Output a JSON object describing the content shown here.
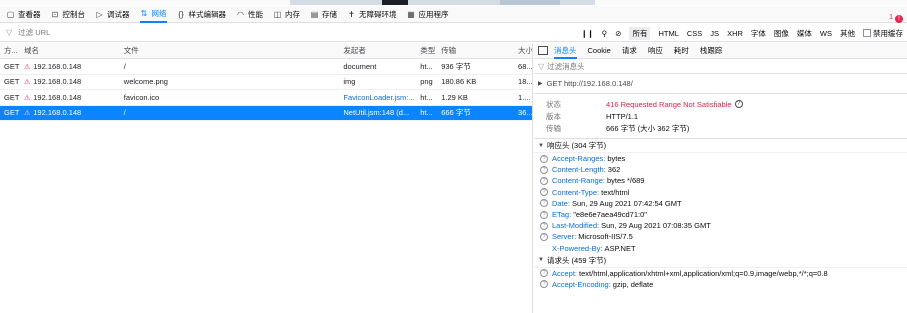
{
  "toolbar": {
    "tools": [
      {
        "label": "查看器",
        "icon": "inspector-icon"
      },
      {
        "label": "控制台",
        "icon": "console-icon"
      },
      {
        "label": "调试器",
        "icon": "debugger-icon"
      },
      {
        "label": "网络",
        "icon": "network-icon"
      },
      {
        "label": "样式编辑器",
        "icon": "style-editor-icon"
      },
      {
        "label": "性能",
        "icon": "performance-icon"
      },
      {
        "label": "内存",
        "icon": "memory-icon"
      },
      {
        "label": "存储",
        "icon": "storage-icon"
      },
      {
        "label": "无障碍环境",
        "icon": "accessibility-icon"
      },
      {
        "label": "应用程序",
        "icon": "application-icon"
      }
    ],
    "error_count": "1"
  },
  "filterbar": {
    "placeholder": "过滤 URL",
    "type_filters": [
      "所有",
      "HTML",
      "CSS",
      "JS",
      "XHR",
      "字体",
      "图像",
      "媒体",
      "WS",
      "其他"
    ],
    "disable_cache_label": "禁用缓存"
  },
  "table": {
    "headers": [
      "方...",
      "域名",
      "文件",
      "发起者",
      "类型",
      "传输",
      "大小"
    ],
    "rows": [
      {
        "method": "GET",
        "domain": "192.168.0.148",
        "file": "/",
        "initiator": "document",
        "type": "ht...",
        "transferred": "936 字节",
        "size": "68...",
        "selected": false
      },
      {
        "method": "GET",
        "domain": "192.168.0.148",
        "file": "welcome.png",
        "initiator": "img",
        "type": "png",
        "transferred": "180.86 KB",
        "size": "18...",
        "selected": false
      },
      {
        "method": "GET",
        "domain": "192.168.0.148",
        "file": "favicon.ico",
        "initiator": "FaviconLoader.jsm:...",
        "type": "ht...",
        "transferred": "1.29 KB",
        "size": "1....",
        "selected": false
      },
      {
        "method": "GET",
        "domain": "192.168.0.148",
        "file": "/",
        "initiator": "NetUtil.jsm:148 (d...",
        "type": "ht...",
        "transferred": "666 字节",
        "size": "36...",
        "selected": true
      }
    ]
  },
  "detail": {
    "tabs": [
      "消息头",
      "Cookie",
      "请求",
      "响应",
      "耗时",
      "栈跟踪"
    ],
    "filter_placeholder": "过滤消息头",
    "request_line": "GET http://192.168.0.148/",
    "summary": [
      {
        "k": "状态",
        "v": "416 Requested Range Not Satisfiable",
        "bad": true
      },
      {
        "k": "版本",
        "v": "HTTP/1.1",
        "bad": false
      },
      {
        "k": "传输",
        "v": "666 字节 (大小 362 字节)",
        "bad": false
      }
    ],
    "response_headers_title": "响应头 (304 字节)",
    "response_headers": [
      {
        "name": "Accept-Ranges:",
        "value": "bytes"
      },
      {
        "name": "Content-Length:",
        "value": "362"
      },
      {
        "name": "Content-Range:",
        "value": "bytes */689"
      },
      {
        "name": "Content-Type:",
        "value": "text/html"
      },
      {
        "name": "Date:",
        "value": "Sun, 29 Aug 2021 07:42:54 GMT"
      },
      {
        "name": "ETag:",
        "value": "\"e8e6e7aea49cd71:0\""
      },
      {
        "name": "Last-Modified:",
        "value": "Sun, 29 Aug 2021 07:08:35 GMT"
      },
      {
        "name": "Server:",
        "value": "Microsoft-IIS/7.5"
      },
      {
        "name": "X-Powered-By:",
        "value": "ASP.NET",
        "noicon": true
      }
    ],
    "request_headers_title": "请求头 (459 字节)",
    "request_headers": [
      {
        "name": "Accept:",
        "value": "text/html,application/xhtml+xml,application/xml;q=0.9,image/webp,*/*;q=0.8"
      },
      {
        "name": "Accept-Encoding:",
        "value": "gzip, deflate"
      }
    ]
  }
}
